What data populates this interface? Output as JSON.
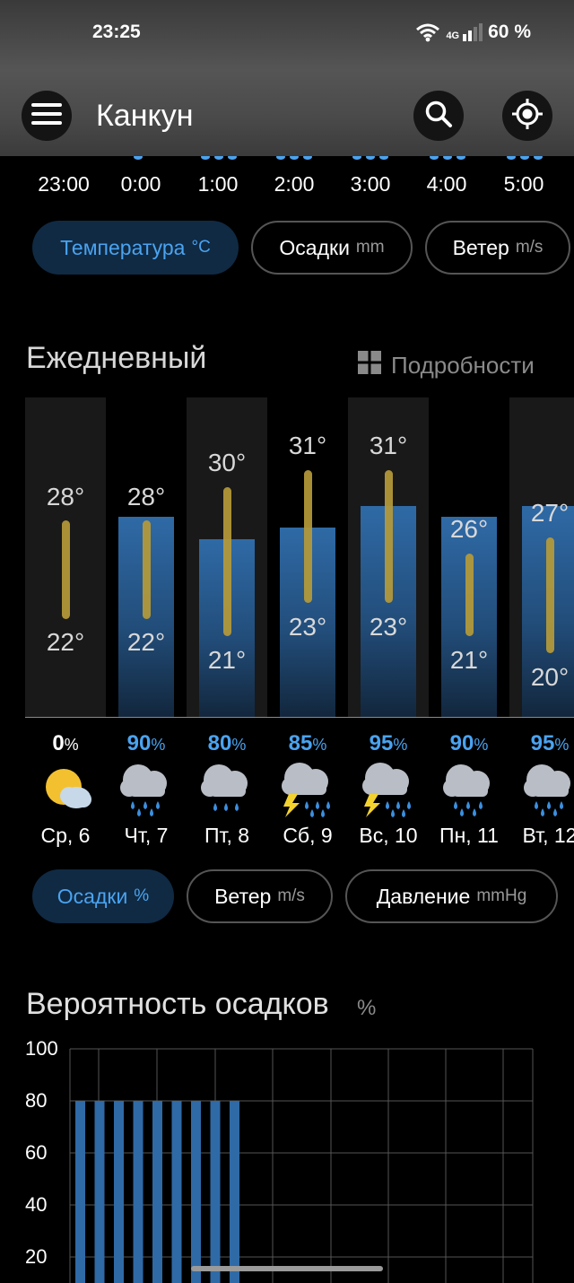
{
  "status": {
    "time": "23:25",
    "network": "4G",
    "battery": "60 %"
  },
  "header": {
    "city": "Канкун"
  },
  "icons": {
    "menu": "menu-icon",
    "search": "search-icon",
    "location": "locate-icon",
    "wifi": "wifi-icon",
    "signal": "signal-icon",
    "grid": "grid-icon",
    "sun_cloud": "sun-cloud-icon",
    "rain": "rain-cloud-icon",
    "storm": "thunderstorm-icon"
  },
  "hourly": {
    "times": [
      "23:00",
      "0:00",
      "1:00",
      "2:00",
      "3:00",
      "4:00",
      "5:00"
    ]
  },
  "hourly_tabs": [
    {
      "label": "Температура",
      "unit": "°C",
      "active": true
    },
    {
      "label": "Осадки",
      "unit": "mm",
      "active": false
    },
    {
      "label": "Ветер",
      "unit": "m/s",
      "active": false
    }
  ],
  "daily": {
    "title": "Ежедневный",
    "details_label": "Подробности",
    "days": [
      {
        "label": "Ср, 6",
        "high": "28°",
        "low": "22°",
        "precip": "0",
        "pct": "%",
        "icon": "sun-cloud-icon"
      },
      {
        "label": "Чт, 7",
        "high": "28°",
        "low": "22°",
        "precip": "90",
        "pct": "%",
        "icon": "rain-cloud-icon"
      },
      {
        "label": "Пт, 8",
        "high": "30°",
        "low": "21°",
        "precip": "80",
        "pct": "%",
        "icon": "rain-cloud-icon"
      },
      {
        "label": "Сб, 9",
        "high": "31°",
        "low": "23°",
        "precip": "85",
        "pct": "%",
        "icon": "thunderstorm-icon"
      },
      {
        "label": "Вс, 10",
        "high": "31°",
        "low": "23°",
        "precip": "95",
        "pct": "%",
        "icon": "thunderstorm-icon"
      },
      {
        "label": "Пн, 11",
        "high": "26°",
        "low": "21°",
        "precip": "90",
        "pct": "%",
        "icon": "rain-cloud-icon"
      },
      {
        "label": "Вт, 12",
        "high": "27°",
        "low": "20°",
        "precip": "95",
        "pct": "%",
        "icon": "rain-cloud-icon"
      }
    ]
  },
  "daily_tabs": [
    {
      "label": "Осадки",
      "unit": "%",
      "active": true
    },
    {
      "label": "Ветер",
      "unit": "m/s",
      "active": false
    },
    {
      "label": "Давление",
      "unit": "mmHg",
      "active": false
    }
  ],
  "probability": {
    "title": "Вероятность осадков",
    "unit": "%"
  },
  "colors": {
    "accent": "#4aa3f0",
    "bar": "#2f6aa6",
    "range": "#b59a3a",
    "active_pill_bg": "#102a43"
  },
  "chart_data": {
    "type": "bar",
    "title": "Вероятность осадков",
    "ylabel": "%",
    "ylim": [
      0,
      100
    ],
    "yticks": [
      100,
      80,
      60,
      40,
      20
    ],
    "grid": true,
    "values": [
      80,
      80,
      80,
      80,
      80,
      80,
      80,
      80,
      80
    ]
  }
}
